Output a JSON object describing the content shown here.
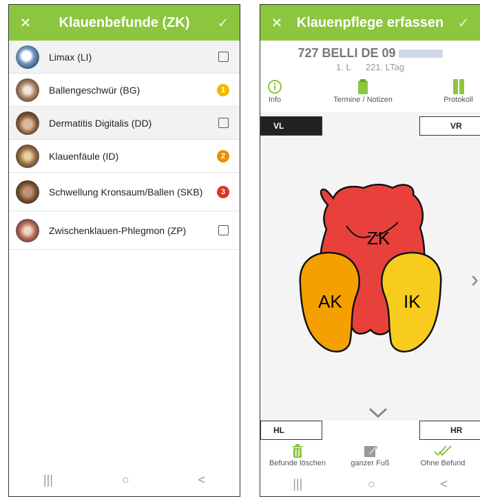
{
  "left": {
    "title": "Klauenbefunde (ZK)",
    "close": "✕",
    "confirm": "✓",
    "items": [
      {
        "label": "Limax (LI)",
        "badge": ""
      },
      {
        "label": "Ballengeschwür (BG)",
        "badge": "1"
      },
      {
        "label": "Dermatitis Digitalis (DD)",
        "badge": ""
      },
      {
        "label": "Klauenfäule (ID)",
        "badge": "2"
      },
      {
        "label": "Schwellung Kronsaum/Ballen (SKB)",
        "badge": "3"
      },
      {
        "label": "Zwischenklauen-Phlegmon (ZP)",
        "badge": ""
      }
    ],
    "nav": {
      "recent": "|||",
      "home": "○",
      "back": "<"
    }
  },
  "right": {
    "title": "Klauenpflege erfassen",
    "close": "✕",
    "confirm": "✓",
    "animal_id": "727 BELLI DE 09",
    "lactation": "1. L",
    "lac_day": "221. LTag",
    "tabs": {
      "info": "Info",
      "termine": "Termine / Notizen",
      "protokoll": "Protokoll"
    },
    "legs": {
      "vl": "VL",
      "vr": "VR",
      "hl": "HL",
      "hr": "HR"
    },
    "zones": {
      "zk": "ZK",
      "ak": "AK",
      "ik": "IK"
    },
    "next": "›",
    "down": "⌄",
    "actions": {
      "delete": "Befunde löschen",
      "whole": "ganzer Fuß",
      "none": "Ohne Befund"
    },
    "nav": {
      "recent": "|||",
      "home": "○",
      "back": "<"
    }
  },
  "colors": {
    "brand_green": "#8cc63f",
    "zone_red": "#e8413c",
    "zone_orange": "#f5a000",
    "zone_yellow": "#f7cc1e",
    "badge_yellow": "#f5b800",
    "badge_orange": "#f08c00",
    "badge_red": "#d9342b"
  }
}
